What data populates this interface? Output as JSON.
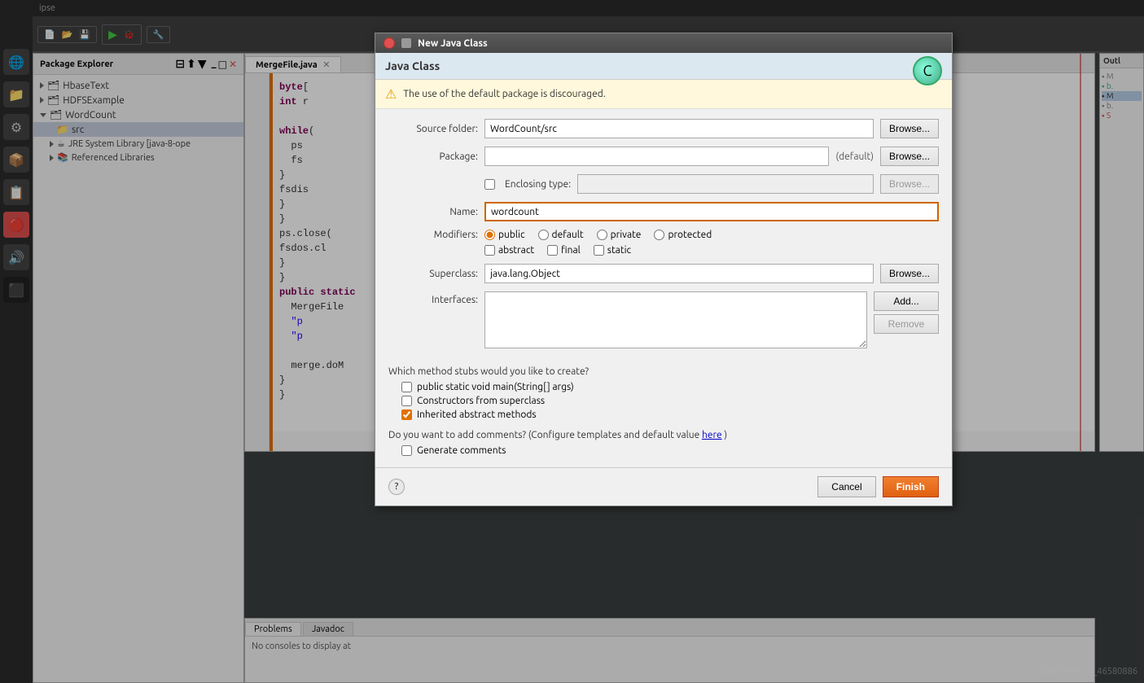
{
  "app": {
    "title": "ipse",
    "bg_color": "#3c3f41"
  },
  "taskbar": {
    "icons": [
      "🌐",
      "📁",
      "🔧",
      "📦",
      "⚙",
      "📋",
      "🔴",
      "🔊",
      "⬛"
    ]
  },
  "package_explorer": {
    "title": "Package Explorer",
    "items": [
      {
        "label": "HbaseText",
        "level": 1,
        "expanded": false
      },
      {
        "label": "HDFSExample",
        "level": 1,
        "expanded": false
      },
      {
        "label": "WordCount",
        "level": 1,
        "expanded": true
      },
      {
        "label": "src",
        "level": 2,
        "expanded": false
      },
      {
        "label": "JRE System Library [java-8-ope",
        "level": 2,
        "expanded": false
      },
      {
        "label": "Referenced Libraries",
        "level": 2,
        "expanded": false
      }
    ]
  },
  "editor": {
    "tab_label": "MergeFile.java",
    "code_lines": [
      {
        "num": "",
        "text": "byte["
      },
      {
        "num": "",
        "text": "int r"
      },
      {
        "num": "",
        "text": ""
      },
      {
        "num": "",
        "text": "while("
      },
      {
        "num": "",
        "text": "  ps"
      },
      {
        "num": "",
        "text": "  fs"
      },
      {
        "num": "",
        "text": ""
      },
      {
        "num": "",
        "text": "}"
      },
      {
        "num": "",
        "text": "fsdis"
      },
      {
        "num": "",
        "text": "}"
      },
      {
        "num": "",
        "text": "}"
      },
      {
        "num": "",
        "text": "ps.close("
      },
      {
        "num": "",
        "text": "fsdos.cl"
      },
      {
        "num": "",
        "text": "}"
      },
      {
        "num": "",
        "text": "}"
      },
      {
        "num": "",
        "text": "public static"
      },
      {
        "num": "",
        "text": "  MergeFile"
      },
      {
        "num": "",
        "text": "  \"p"
      },
      {
        "num": "",
        "text": "  \"p"
      },
      {
        "num": "",
        "text": ""
      },
      {
        "num": "",
        "text": "  merge.doM"
      },
      {
        "num": "",
        "text": ""
      },
      {
        "num": "",
        "text": "}"
      },
      {
        "num": "",
        "text": "}"
      }
    ]
  },
  "bottom_panel": {
    "tabs": [
      "Problems",
      "Javadoc"
    ],
    "active_tab": "Problems",
    "content": "No consoles to display at"
  },
  "dialog": {
    "title": "New Java Class",
    "section_header": "Java Class",
    "warning_text": "The use of the default package is discouraged.",
    "source_folder_label": "Source folder:",
    "source_folder_value": "WordCount/src",
    "package_label": "Package:",
    "package_value": "",
    "package_default": "(default)",
    "enclosing_type_label": "Enclosing type:",
    "enclosing_type_value": "",
    "enclosing_type_checked": false,
    "name_label": "Name:",
    "name_value": "wordcount",
    "modifiers_label": "Modifiers:",
    "modifiers": {
      "options": [
        "public",
        "default",
        "private",
        "protected"
      ],
      "selected": "public",
      "extra_options": [
        {
          "label": "abstract",
          "checked": false
        },
        {
          "label": "final",
          "checked": false
        },
        {
          "label": "static",
          "checked": false
        }
      ]
    },
    "superclass_label": "Superclass:",
    "superclass_value": "java.lang.Object",
    "interfaces_label": "Interfaces:",
    "stubs_title": "Which method stubs would you like to create?",
    "stubs": [
      {
        "label": "public static void main(String[] args)",
        "checked": false
      },
      {
        "label": "Constructors from superclass",
        "checked": false
      },
      {
        "label": "Inherited abstract methods",
        "checked": true
      }
    ],
    "comments_text": "Do you want to add comments? (Configure templates and default value",
    "comments_link": "here",
    "comments_link_suffix": ")",
    "generate_comments_label": "Generate comments",
    "generate_comments_checked": false,
    "browse_label": "Browse...",
    "browse_label_disabled": "Browse...",
    "add_label": "Add...",
    "remove_label": "Remove",
    "cancel_label": "Cancel",
    "finish_label": "Finish",
    "help_label": "?"
  },
  "watermark": "CSDN @weixin_46580886"
}
